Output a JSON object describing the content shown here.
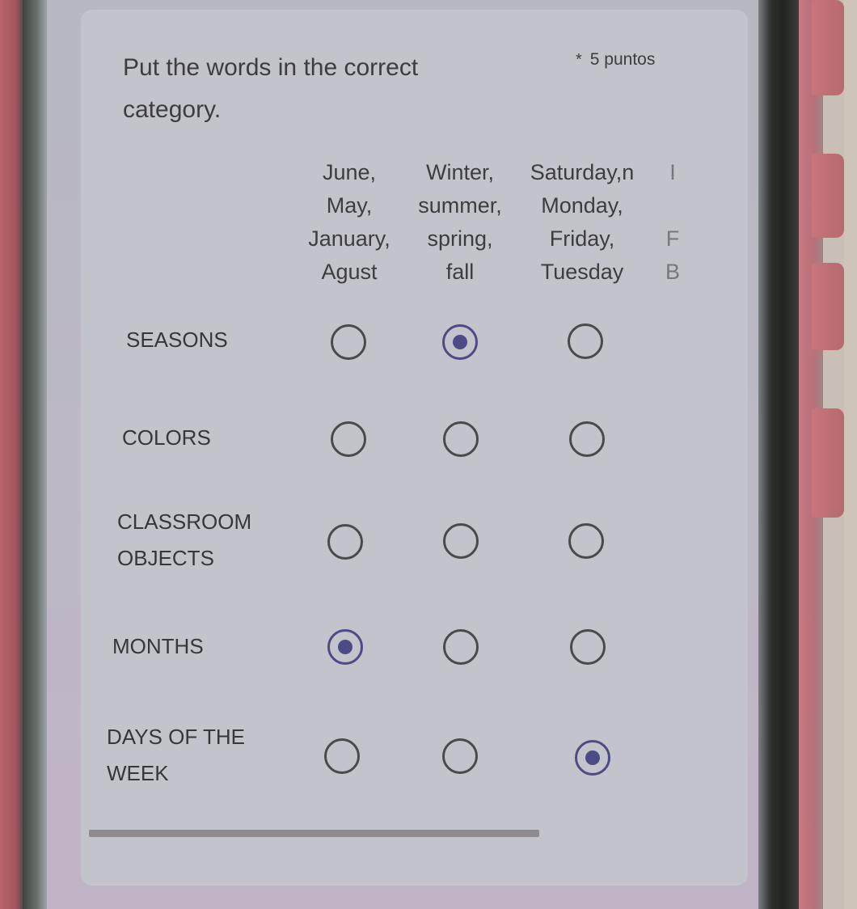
{
  "question": {
    "title": "Put the words in the correct category.",
    "required_marker": "*",
    "points": "5 puntos"
  },
  "columns": [
    {
      "lines": [
        "June,",
        "May,",
        "January,",
        "Agust"
      ]
    },
    {
      "lines": [
        "Winter,",
        "summer,",
        "spring,",
        "fall"
      ]
    },
    {
      "lines": [
        "Saturday,n",
        "Monday,",
        "Friday,",
        "Tuesday"
      ]
    },
    {
      "lines": [
        "I",
        "",
        "F",
        "B"
      ]
    }
  ],
  "rows": [
    {
      "label": "SEASONS",
      "selected_column": 2
    },
    {
      "label": "COLORS",
      "selected_column": null
    },
    {
      "label": "CLASSROOM OBJECTS",
      "selected_column": null
    },
    {
      "label": "MONTHS",
      "selected_column": 1
    },
    {
      "label": "DAYS OF THE WEEK",
      "selected_column": 3
    }
  ],
  "colors": {
    "accent": "#4d4b85",
    "text": "#3d3d3f",
    "card": "#c3c3cb"
  }
}
